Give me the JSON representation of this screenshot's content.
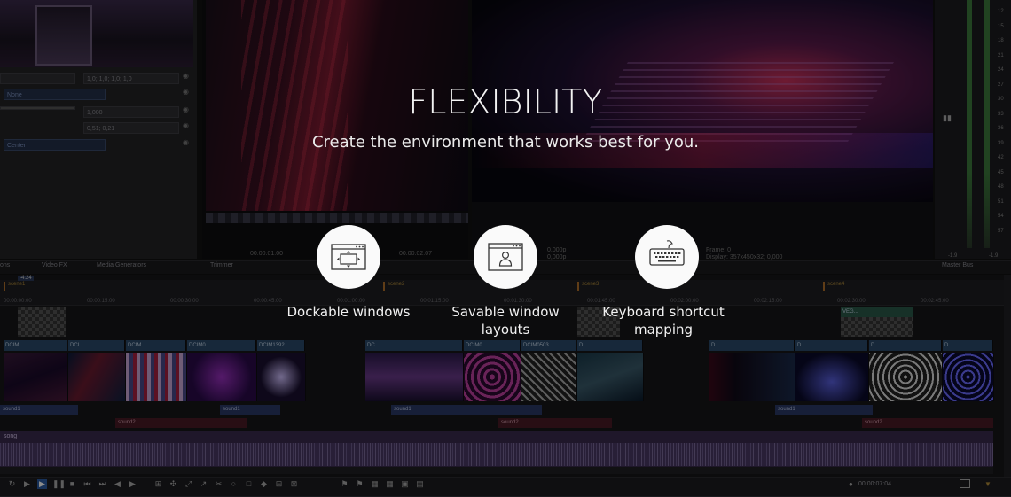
{
  "properties": {
    "field1": "1,0; 1,0; 1,0; 1,0",
    "dropdown1": "None",
    "field2": "1,000",
    "field3": "0,51; 0,21",
    "dropdown2": "Center"
  },
  "tabs": {
    "tab1": "ons",
    "tab2": "Video FX",
    "tab3": "Media Generators",
    "tab4": "Trimmer",
    "tab5": "Master Bus"
  },
  "preview": {
    "trimmer_time": "00:00:01:00",
    "trimmer_time2": "00:00:02:07",
    "frame_label": "Frame:",
    "frame_value": "0",
    "display_label": "Display:",
    "display_value": "357x450x32; 0,000",
    "rate1": "0,000p",
    "rate2": "0,000p"
  },
  "meter_scale": [
    "12",
    "15",
    "18",
    "21",
    "24",
    "27",
    "30",
    "33",
    "36",
    "39",
    "42",
    "45",
    "48",
    "51",
    "54",
    "57",
    "-1.9",
    "-1.9"
  ],
  "timeline": {
    "cursor_pos": "-4:24",
    "scene_markers": [
      "scene1",
      "scene2",
      "scene3",
      "scene4"
    ],
    "ticks": [
      "00:00:00:00",
      "00:00:15:00",
      "00:00:30:00",
      "00:00:45:00",
      "00:01:00:00",
      "00:01:15:00",
      "00:01:30:00",
      "00:01:45:00",
      "00:02:00:00",
      "00:02:15:00",
      "00:02:30:00",
      "00:02:45:00"
    ],
    "video_clips": [
      "DCIM...",
      "DCI...",
      "DCIM...",
      "DCIM0",
      "DCIM1392",
      "DC...",
      "DCIM0",
      "DCIM0503",
      "D..."
    ],
    "fx_clip_label": "VEG...",
    "audio": {
      "sound1": "sound1",
      "sound2": "sound2",
      "song": "song"
    },
    "timecode": "00:00:07:04"
  },
  "overlay": {
    "headline": "FLEXIBILITY",
    "subline": "Create the environment that works best for you.",
    "features": [
      {
        "icon": "dockable-window-icon",
        "label": "Dockable windows"
      },
      {
        "icon": "window-layout-user-icon",
        "label": "Savable window layouts"
      },
      {
        "icon": "keyboard-icon",
        "label": "Keyboard shortcut mapping"
      }
    ]
  }
}
